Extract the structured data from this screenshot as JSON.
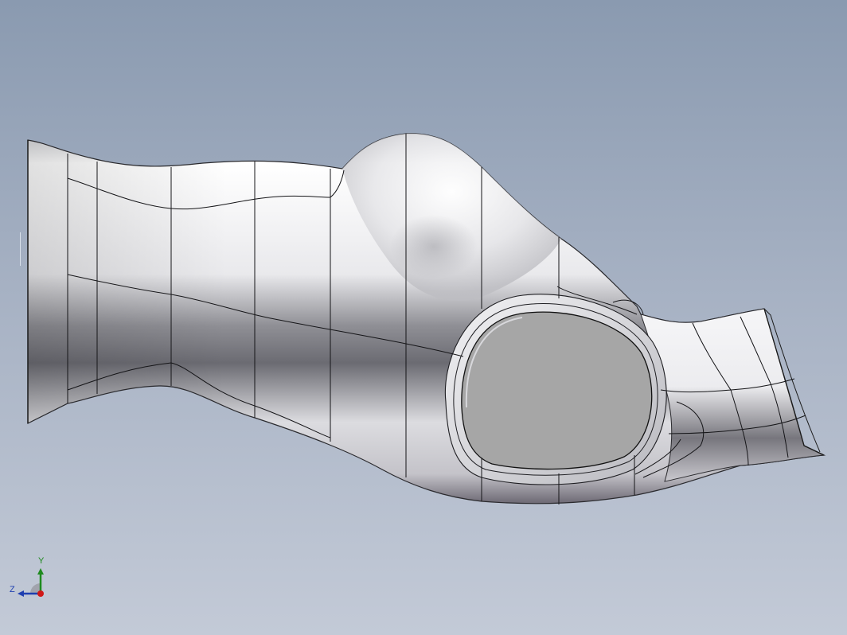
{
  "viewport": {
    "background_top": "#8a9ab0",
    "background_bottom": "#c3cad7"
  },
  "model": {
    "surface_highlight": "#f7f7f9",
    "surface_shadow": "#5f5f66",
    "edge_color": "#111111",
    "opening_face_color": "#a6a6a6"
  },
  "triad": {
    "y_label": "Y",
    "z_label": "Z",
    "y_axis_color": "#1e8a1e",
    "z_axis_color": "#1f3fb0",
    "x_axis_color": "#d01818",
    "icon": "view-orientation-triad-icon"
  }
}
